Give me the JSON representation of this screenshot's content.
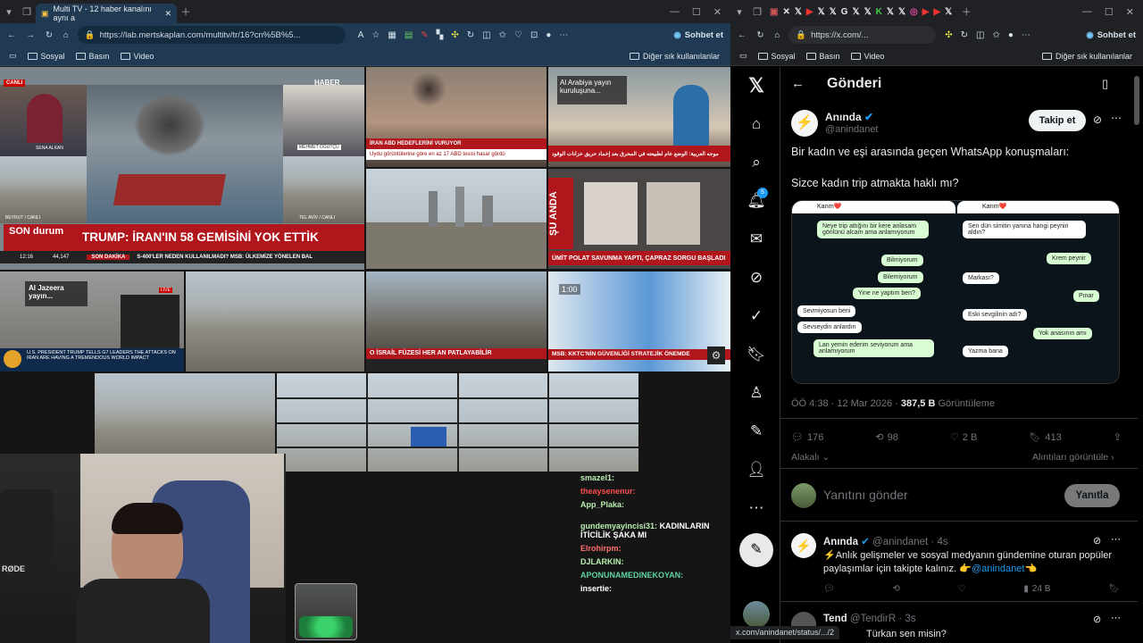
{
  "left_browser": {
    "tab_title": "Multi TV - 12 haber kanalını aynı a",
    "url": "https://lab.mertskaplan.com/multitv/tr/16?cn%5B%5...",
    "profile_button": "Sohbet et",
    "bookmarks": [
      "Sosyal",
      "Basın",
      "Video"
    ],
    "other_bookmarks": "Diğer sık kullanılanlar",
    "tiles": {
      "canli": "CANLI",
      "haber_logo": "HABER",
      "sena": "SENA ALKAN",
      "mehmet": "MEHMET ÖĞÜTÇÜ",
      "beyrut": "BEYRUT / CANLI",
      "telaviv": "TEL AVİV / CANLI",
      "son_durum": "SON durum",
      "headline": "TRUMP: İRAN'IN 58 GEMİSİNİ YOK ETTİK",
      "time": "12:16",
      "index": "44,147",
      "son_dakika": "SON DAKİKA",
      "sub_ticker": "S-400'LER NEDEN KULLANILMADI? MSB: ÜLKEMİZE YÖNELEN BAL",
      "iran_ticker": "İRAN ABD HEDEFLERİNİ VURUYOR",
      "iran_sub": "Uydu görüntülerine göre en az 17 ABD tesisi hasar gördü",
      "al_arabiya": "Al Arabiya yayın kuruluşuna...",
      "arabic_ticker": "موجه العربية: الوضع عام لطبيعته في المحرق بعد إخماد حريق خزانات الوقود",
      "su_anda": "ŞU ANDA",
      "umit": "ÜMİT POLAT SAVUNMA YAPTI, ÇAPRAZ SORGU BAŞLADI",
      "al_jazeera": "Al Jazeera yayın...",
      "aj_ticker": "U.S. PRESIDENT TRUMP TELLS G7 LEADERS THE ATTACKS ON IRAN ARE HAVING A TREMENDOUS WORLD IMPACT",
      "live": "LIVE",
      "israil": "O İSRAİL FÜZESİ HER AN PATLAYABİLİR",
      "msb": "MSB: KKTC'NİN GÜVENLİĞİ STRATEJİK ÖNEMDE",
      "clock": "1:00"
    },
    "chat": [
      {
        "user": "smazel1:",
        "color": "#b8f0b0",
        "text": ""
      },
      {
        "user": "theaysenenur:",
        "color": "#ff4d4d",
        "text": ""
      },
      {
        "user": "App_Plaka:",
        "color": "#b8f0b0",
        "text": ""
      },
      {
        "user": "gundemyayincisi31:",
        "color": "#b8f0b0",
        "text": "KADINLARIN İTİCİLİK ŞAKA MI"
      },
      {
        "user": "Elrohirpm:",
        "color": "#ff6f6f",
        "text": ""
      },
      {
        "user": "DJLARKIN:",
        "color": "#b8f0b0",
        "text": ""
      },
      {
        "user": "APONUNAMEDINEKOYAN:",
        "color": "#5fd4a0",
        "text": ""
      },
      {
        "user": "insertie:",
        "color": "#ffffff",
        "text": ""
      }
    ],
    "rode": "RØDE"
  },
  "right_browser": {
    "url": "https://x.com/...",
    "profile_button": "Sohbet et",
    "bookmarks": [
      "Sosyal",
      "Basın",
      "Video"
    ],
    "other_bookmarks": "Diğer sık kullanılanlar",
    "notif_count": "5",
    "page_title": "Gönderi",
    "post": {
      "name": "Anında",
      "handle": "@anindanet",
      "follow": "Takip et",
      "text1": "Bir kadın ve eşi arasında geçen WhatsApp konuşmaları:",
      "text2": "Sizce kadın trip atmakta haklı mı?",
      "time": "ÖÖ 4:38 · 12 Mar 2026 · ",
      "views_num": "387,5 B",
      "views_label": " Görüntüleme",
      "replies": "176",
      "reposts": "98",
      "likes": "2 B",
      "bookmarks": "413",
      "related": "Alakalı",
      "quotes": "Alıntıları görüntüle"
    },
    "whatsapp": {
      "left_contact": "Karım❤️",
      "right_contact": "Karım❤️",
      "left_msgs": [
        {
          "text": "Neye trip attığını bir kere anlasam gönlünü alcam ama anlamıyorum",
          "me": true
        },
        {
          "text": "Bilmiyorum",
          "me": true
        },
        {
          "text": "Bilemiyorum",
          "me": true
        },
        {
          "text": "Yine ne yaptım ben?",
          "me": true
        },
        {
          "text": "Sevmiyosun beni",
          "me": false
        },
        {
          "text": "Sevseydin anlardın",
          "me": false
        },
        {
          "text": "Lan yemin ederim seviyorum ama anlamıyorum",
          "me": true
        }
      ],
      "right_msgs": [
        {
          "text": "Sen dün simitin yanına hangi peyniri aldın?",
          "me": false
        },
        {
          "text": "Krem peynir",
          "me": true
        },
        {
          "text": "Markası?",
          "me": false
        },
        {
          "text": "Pınar",
          "me": true
        },
        {
          "text": "Eski sevgilinin adı?",
          "me": false
        },
        {
          "text": "Yok anasının amı",
          "me": true
        },
        {
          "text": "Yazma bana",
          "me": false
        }
      ]
    },
    "reply_placeholder": "Yanıtını gönder",
    "reply_button": "Yanıtla",
    "reply1": {
      "name": "Anında",
      "handle": "@anindanet · 4s",
      "text": "⚡️Anlık gelişmeler ve sosyal medyanın gündemine oturan popüler paylaşımlar için takipte kalınız. 👉",
      "mention": "@anindanet",
      "views": "24 B"
    },
    "reply2": {
      "name": "Tend",
      "handle": "@TendirR · 3s",
      "text": "Türkan sen misin?"
    },
    "status_url": "x.com/anindanet/status/.../2"
  }
}
